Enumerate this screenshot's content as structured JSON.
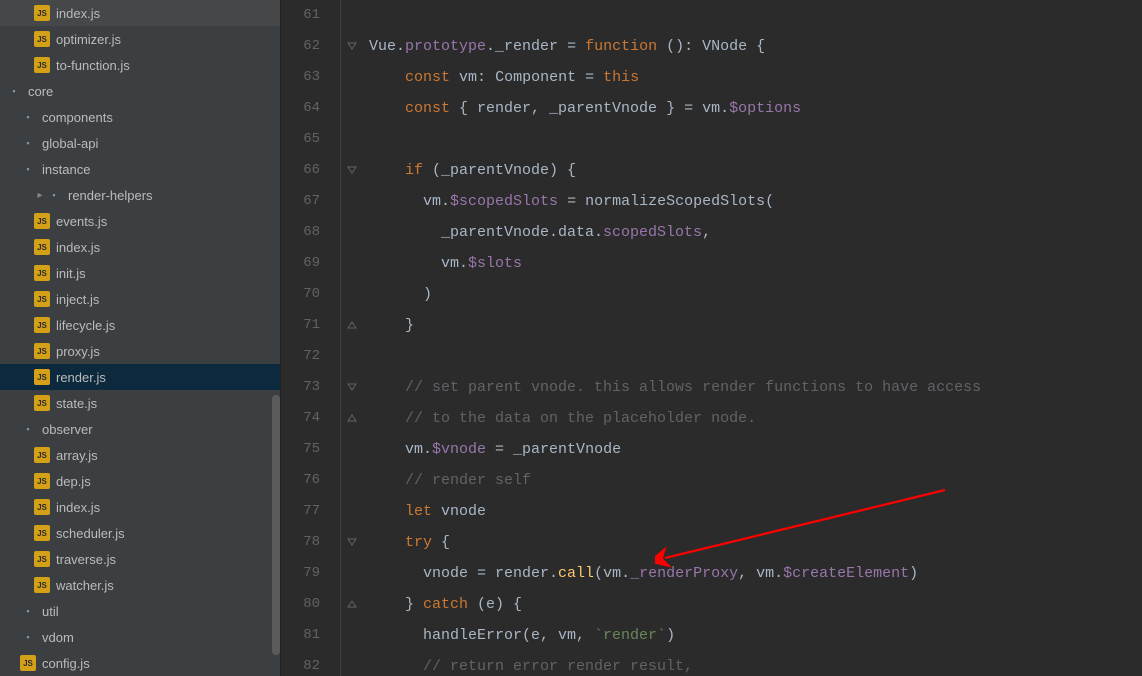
{
  "sidebar": {
    "items": [
      {
        "label": "index.js",
        "type": "js",
        "depth": 2
      },
      {
        "label": "optimizer.js",
        "type": "js",
        "depth": 2
      },
      {
        "label": "to-function.js",
        "type": "js",
        "depth": 2
      },
      {
        "label": "core",
        "type": "folder",
        "depth": 0
      },
      {
        "label": "components",
        "type": "folder",
        "depth": 1
      },
      {
        "label": "global-api",
        "type": "folder",
        "depth": 1
      },
      {
        "label": "instance",
        "type": "folder",
        "depth": 1,
        "expanded": true
      },
      {
        "label": "render-helpers",
        "type": "folder",
        "depth": 2,
        "arrow": true
      },
      {
        "label": "events.js",
        "type": "js",
        "depth": 2
      },
      {
        "label": "index.js",
        "type": "js",
        "depth": 2
      },
      {
        "label": "init.js",
        "type": "js",
        "depth": 2
      },
      {
        "label": "inject.js",
        "type": "js",
        "depth": 2
      },
      {
        "label": "lifecycle.js",
        "type": "js",
        "depth": 2
      },
      {
        "label": "proxy.js",
        "type": "js",
        "depth": 2
      },
      {
        "label": "render.js",
        "type": "js",
        "depth": 2,
        "selected": true
      },
      {
        "label": "state.js",
        "type": "js",
        "depth": 2
      },
      {
        "label": "observer",
        "type": "folder",
        "depth": 1,
        "expanded": true
      },
      {
        "label": "array.js",
        "type": "js",
        "depth": 2
      },
      {
        "label": "dep.js",
        "type": "js",
        "depth": 2
      },
      {
        "label": "index.js",
        "type": "js",
        "depth": 2
      },
      {
        "label": "scheduler.js",
        "type": "js",
        "depth": 2
      },
      {
        "label": "traverse.js",
        "type": "js",
        "depth": 2
      },
      {
        "label": "watcher.js",
        "type": "js",
        "depth": 2
      },
      {
        "label": "util",
        "type": "folder",
        "depth": 1
      },
      {
        "label": "vdom",
        "type": "folder",
        "depth": 1
      },
      {
        "label": "config.js",
        "type": "js",
        "depth": 1
      }
    ]
  },
  "editor": {
    "startLine": 61,
    "lines": [
      {
        "n": 61,
        "tokens": []
      },
      {
        "n": 62,
        "fold": "down",
        "tokens": [
          {
            "t": "Vue.",
            "c": "txt"
          },
          {
            "t": "prototype",
            "c": "prop"
          },
          {
            "t": ".",
            "c": "txt"
          },
          {
            "t": "_render",
            "c": "txt"
          },
          {
            "t": " = ",
            "c": "txt"
          },
          {
            "t": "function ",
            "c": "kw"
          },
          {
            "t": "(): ",
            "c": "txt"
          },
          {
            "t": "VNode",
            "c": "typ"
          },
          {
            "t": " {",
            "c": "txt"
          }
        ]
      },
      {
        "n": 63,
        "indent": 2,
        "tokens": [
          {
            "t": "const ",
            "c": "kw"
          },
          {
            "t": "vm",
            "c": "txt"
          },
          {
            "t": ": ",
            "c": "txt"
          },
          {
            "t": "Component",
            "c": "typ"
          },
          {
            "t": " = ",
            "c": "txt"
          },
          {
            "t": "this",
            "c": "kw"
          }
        ]
      },
      {
        "n": 64,
        "indent": 2,
        "tokens": [
          {
            "t": "const ",
            "c": "kw"
          },
          {
            "t": "{ render, _parentVnode } = ",
            "c": "txt"
          },
          {
            "t": "vm.",
            "c": "txt"
          },
          {
            "t": "$options",
            "c": "prop"
          }
        ]
      },
      {
        "n": 65,
        "tokens": []
      },
      {
        "n": 66,
        "fold": "down",
        "indent": 2,
        "tokens": [
          {
            "t": "if ",
            "c": "kw"
          },
          {
            "t": "(_parentVnode) {",
            "c": "txt"
          }
        ]
      },
      {
        "n": 67,
        "indent": 3,
        "tokens": [
          {
            "t": "vm.",
            "c": "txt"
          },
          {
            "t": "$scopedSlots",
            "c": "prop"
          },
          {
            "t": " = normalizeScopedSlots(",
            "c": "txt"
          }
        ]
      },
      {
        "n": 68,
        "indent": 4,
        "tokens": [
          {
            "t": "_parentVnode.data.",
            "c": "txt"
          },
          {
            "t": "scopedSlots",
            "c": "prop"
          },
          {
            "t": ",",
            "c": "txt"
          }
        ]
      },
      {
        "n": 69,
        "indent": 4,
        "tokens": [
          {
            "t": "vm.",
            "c": "txt"
          },
          {
            "t": "$slots",
            "c": "prop"
          }
        ]
      },
      {
        "n": 70,
        "indent": 3,
        "tokens": [
          {
            "t": ")",
            "c": "txt"
          }
        ]
      },
      {
        "n": 71,
        "fold": "up",
        "indent": 2,
        "tokens": [
          {
            "t": "}",
            "c": "txt"
          }
        ]
      },
      {
        "n": 72,
        "tokens": []
      },
      {
        "n": 73,
        "fold": "down",
        "indent": 2,
        "tokens": [
          {
            "t": "// set parent vnode. this allows render functions to have access",
            "c": "cm"
          }
        ]
      },
      {
        "n": 74,
        "fold": "up",
        "indent": 2,
        "tokens": [
          {
            "t": "// to the data on the placeholder node.",
            "c": "cm"
          }
        ]
      },
      {
        "n": 75,
        "indent": 2,
        "tokens": [
          {
            "t": "vm.",
            "c": "txt"
          },
          {
            "t": "$vnode",
            "c": "prop"
          },
          {
            "t": " = _parentVnode",
            "c": "txt"
          }
        ]
      },
      {
        "n": 76,
        "indent": 2,
        "tokens": [
          {
            "t": "// render self",
            "c": "cm"
          }
        ]
      },
      {
        "n": 77,
        "indent": 2,
        "tokens": [
          {
            "t": "let ",
            "c": "kw"
          },
          {
            "t": "vnode",
            "c": "txt"
          }
        ]
      },
      {
        "n": 78,
        "fold": "down",
        "indent": 2,
        "tokens": [
          {
            "t": "try ",
            "c": "kw"
          },
          {
            "t": "{",
            "c": "txt"
          }
        ]
      },
      {
        "n": 79,
        "indent": 3,
        "tokens": [
          {
            "t": "vnode = render.",
            "c": "txt"
          },
          {
            "t": "call",
            "c": "fn"
          },
          {
            "t": "(vm.",
            "c": "txt"
          },
          {
            "t": "_renderProxy",
            "c": "prop"
          },
          {
            "t": ", vm.",
            "c": "txt"
          },
          {
            "t": "$createElement",
            "c": "prop"
          },
          {
            "t": ")",
            "c": "txt"
          }
        ]
      },
      {
        "n": 80,
        "fold": "up",
        "indent": 2,
        "tokens": [
          {
            "t": "} ",
            "c": "txt"
          },
          {
            "t": "catch ",
            "c": "kw"
          },
          {
            "t": "(e) {",
            "c": "txt"
          }
        ]
      },
      {
        "n": 81,
        "indent": 3,
        "tokens": [
          {
            "t": "handleError(e, vm, ",
            "c": "txt"
          },
          {
            "t": "`render`",
            "c": "str"
          },
          {
            "t": ")",
            "c": "txt"
          }
        ]
      },
      {
        "n": 82,
        "indent": 3,
        "tokens": [
          {
            "t": "// return error render result,",
            "c": "cm"
          }
        ]
      }
    ]
  }
}
